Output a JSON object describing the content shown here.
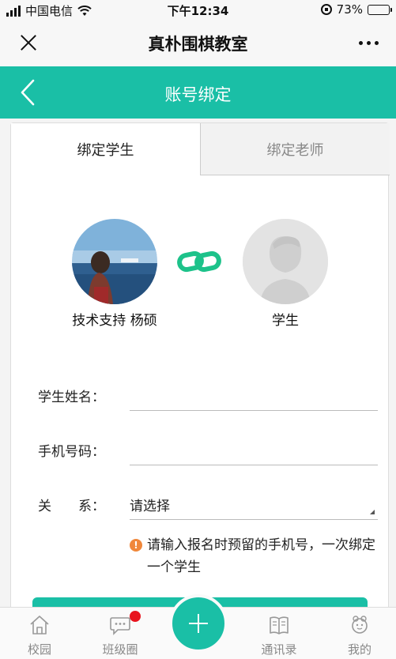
{
  "status_bar": {
    "carrier": "中国电信",
    "time": "下午12:34",
    "battery": "73%",
    "battery_level": 0.73
  },
  "wechat_bar": {
    "title": "真朴围棋教室"
  },
  "header": {
    "title": "账号绑定"
  },
  "tabs": [
    {
      "label": "绑定学生",
      "active": true
    },
    {
      "label": "绑定老师",
      "active": false
    }
  ],
  "binding": {
    "teacher_name": "技术支持 杨硕",
    "student_name": "学生"
  },
  "form": {
    "name_label": "学生姓名：",
    "name_value": "",
    "phone_label": "手机号码：",
    "phone_value": "",
    "relation_label": "关　　系：",
    "relation_value": "请选择",
    "hint": "请输入报名时预留的手机号，一次绑定一个学生"
  },
  "bottom_nav": [
    {
      "label": "校园",
      "icon": "home-icon"
    },
    {
      "label": "班级圈",
      "icon": "chat-bubble-icon",
      "badge": true
    },
    {
      "label": "",
      "icon": "plus-icon"
    },
    {
      "label": "通讯录",
      "icon": "book-icon"
    },
    {
      "label": "我的",
      "icon": "user-icon"
    }
  ],
  "colors": {
    "accent": "#1abfa6",
    "badge": "#e8141e",
    "warning": "#f0873a"
  }
}
